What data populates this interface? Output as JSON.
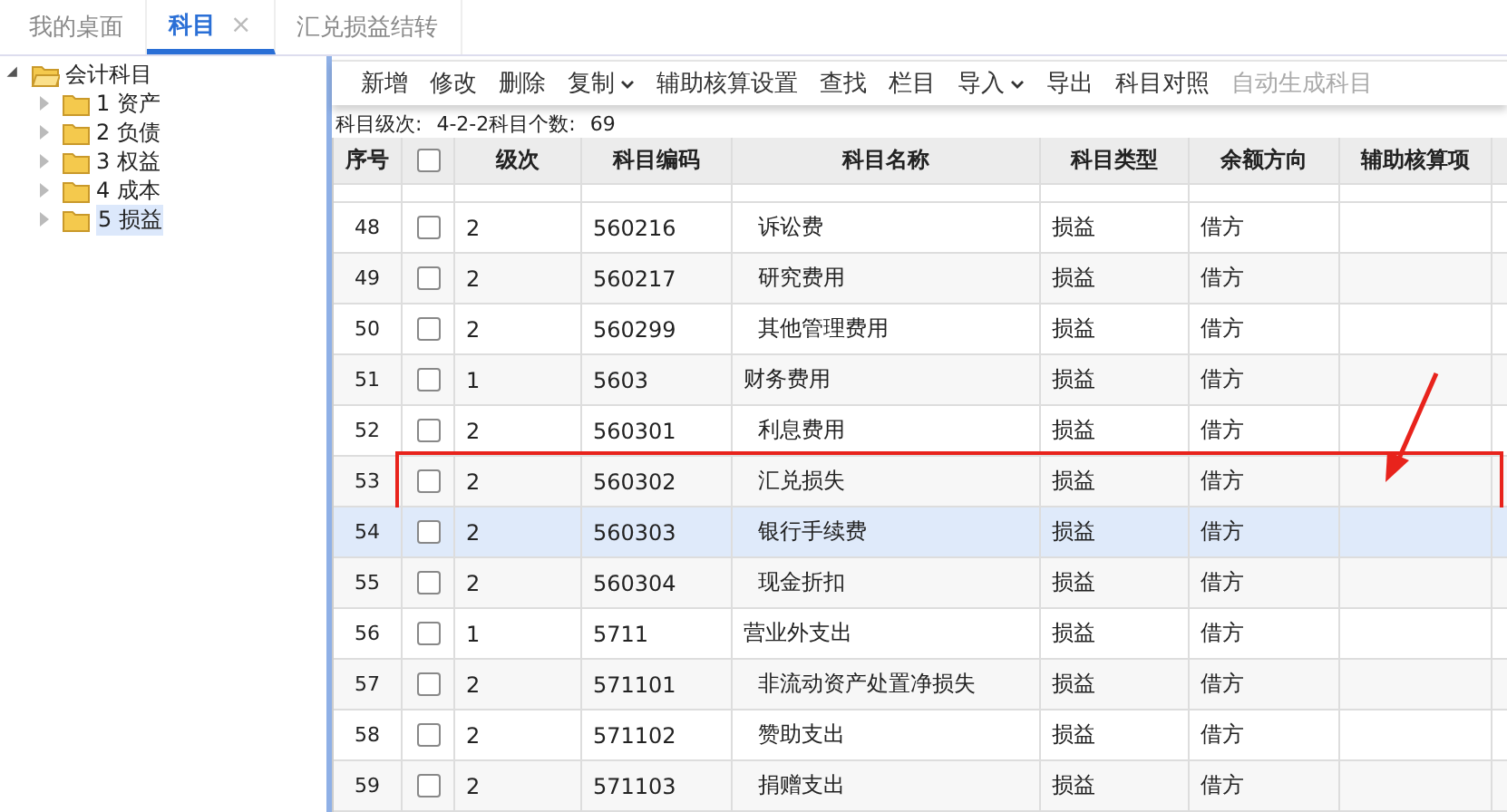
{
  "tabs": [
    {
      "label": "我的桌面",
      "selected": false,
      "closable": false
    },
    {
      "label": "科目",
      "selected": true,
      "closable": true,
      "close_glyph": "×"
    },
    {
      "label": "汇兑损益结转",
      "selected": false,
      "closable": false
    }
  ],
  "tree": {
    "label": "会计科目",
    "expanded": true,
    "children": [
      {
        "label": "1 资产",
        "expanded": false,
        "selected": false
      },
      {
        "label": "2 负债",
        "expanded": false,
        "selected": false
      },
      {
        "label": "3 权益",
        "expanded": false,
        "selected": false
      },
      {
        "label": "4 成本",
        "expanded": false,
        "selected": false
      },
      {
        "label": "5 损益",
        "expanded": false,
        "selected": true
      }
    ]
  },
  "toolbar": [
    {
      "label": "新增",
      "dropdown": false,
      "disabled": false
    },
    {
      "label": "修改",
      "dropdown": false,
      "disabled": false
    },
    {
      "label": "删除",
      "dropdown": false,
      "disabled": false
    },
    {
      "label": "复制",
      "dropdown": true,
      "disabled": false
    },
    {
      "label": "辅助核算设置",
      "dropdown": false,
      "disabled": false
    },
    {
      "label": "查找",
      "dropdown": false,
      "disabled": false
    },
    {
      "label": "栏目",
      "dropdown": false,
      "disabled": false
    },
    {
      "label": "导入",
      "dropdown": true,
      "disabled": false
    },
    {
      "label": "导出",
      "dropdown": false,
      "disabled": false
    },
    {
      "label": "科目对照",
      "dropdown": false,
      "disabled": false
    },
    {
      "label": "自动生成科目",
      "dropdown": false,
      "disabled": true
    }
  ],
  "info": {
    "levels_label": "科目级次:",
    "levels": "4-2-2",
    "count_label": "科目个数:",
    "count": "69"
  },
  "table": {
    "all_checked": false,
    "columns": [
      "序号",
      "",
      "级次",
      "科目编码",
      "科目名称",
      "科目类型",
      "余额方向",
      "辅助核算项"
    ],
    "rows": [
      {
        "no": "48",
        "checked": false,
        "level_text": "2",
        "code": "560216",
        "name": "诉讼费",
        "indented": true,
        "type": "损益",
        "direction": "借方",
        "selected": false,
        "highlighted": false
      },
      {
        "no": "49",
        "checked": false,
        "level_text": "2",
        "code": "560217",
        "name": "研究费用",
        "indented": true,
        "type": "损益",
        "direction": "借方",
        "selected": false,
        "highlighted": false
      },
      {
        "no": "50",
        "checked": false,
        "level_text": "2",
        "code": "560299",
        "name": "其他管理费用",
        "indented": true,
        "type": "损益",
        "direction": "借方",
        "selected": false,
        "highlighted": false
      },
      {
        "no": "51",
        "checked": false,
        "level_text": "1",
        "code": "5603",
        "name": "财务费用",
        "indented": false,
        "type": "损益",
        "direction": "借方",
        "selected": false,
        "highlighted": false
      },
      {
        "no": "52",
        "checked": false,
        "level_text": "2",
        "code": "560301",
        "name": "利息费用",
        "indented": true,
        "type": "损益",
        "direction": "借方",
        "selected": false,
        "highlighted": false
      },
      {
        "no": "53",
        "checked": false,
        "level_text": "2",
        "code": "560302",
        "name": "汇兑损失",
        "indented": true,
        "type": "损益",
        "direction": "借方",
        "selected": false,
        "highlighted": true
      },
      {
        "no": "54",
        "checked": false,
        "level_text": "2",
        "code": "560303",
        "name": "银行手续费",
        "indented": true,
        "type": "损益",
        "direction": "借方",
        "selected": true,
        "highlighted": false
      },
      {
        "no": "55",
        "checked": false,
        "level_text": "2",
        "code": "560304",
        "name": "现金折扣",
        "indented": true,
        "type": "损益",
        "direction": "借方",
        "selected": false,
        "highlighted": false
      },
      {
        "no": "56",
        "checked": false,
        "level_text": "1",
        "code": "5711",
        "name": "营业外支出",
        "indented": false,
        "type": "损益",
        "direction": "借方",
        "selected": false,
        "highlighted": false
      },
      {
        "no": "57",
        "checked": false,
        "level_text": "2",
        "code": "571101",
        "name": "非流动资产处置净损失",
        "indented": true,
        "type": "损益",
        "direction": "借方",
        "selected": false,
        "highlighted": false
      },
      {
        "no": "58",
        "checked": false,
        "level_text": "2",
        "code": "571102",
        "name": "赞助支出",
        "indented": true,
        "type": "损益",
        "direction": "借方",
        "selected": false,
        "highlighted": false
      },
      {
        "no": "59",
        "checked": false,
        "level_text": "2",
        "code": "571103",
        "name": "捐赠支出",
        "indented": true,
        "type": "损益",
        "direction": "借方",
        "selected": false,
        "highlighted": false
      }
    ]
  }
}
